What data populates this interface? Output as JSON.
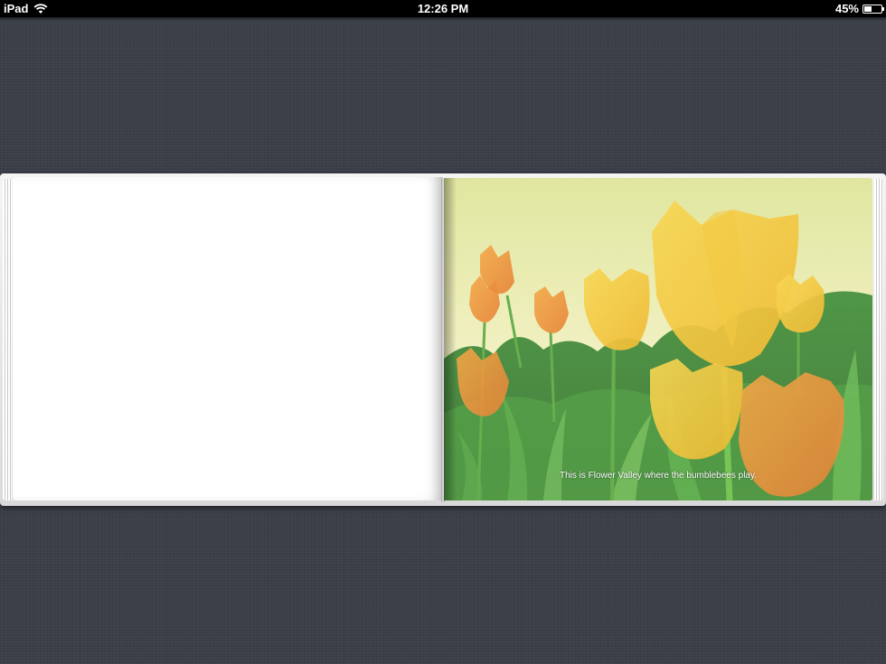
{
  "status_bar": {
    "device": "iPad",
    "time": "12:26 PM",
    "battery_text": "45%",
    "battery_level": 0.45,
    "icons": [
      "wifi-icon",
      "battery-icon"
    ]
  },
  "book": {
    "left_page": {
      "content": ""
    },
    "right_page": {
      "caption": "This is Flower Valley where the bumblebees play.",
      "illustration": "yellow-orange-tulips-field"
    }
  },
  "colors": {
    "background": "#3b3f48",
    "status_bar": "#000000",
    "page": "#ffffff",
    "tulip_yellow": "#f5c22a",
    "tulip_orange": "#ee8a2c",
    "grass_green": "#3f8a34",
    "sky": "#eef0b4"
  }
}
